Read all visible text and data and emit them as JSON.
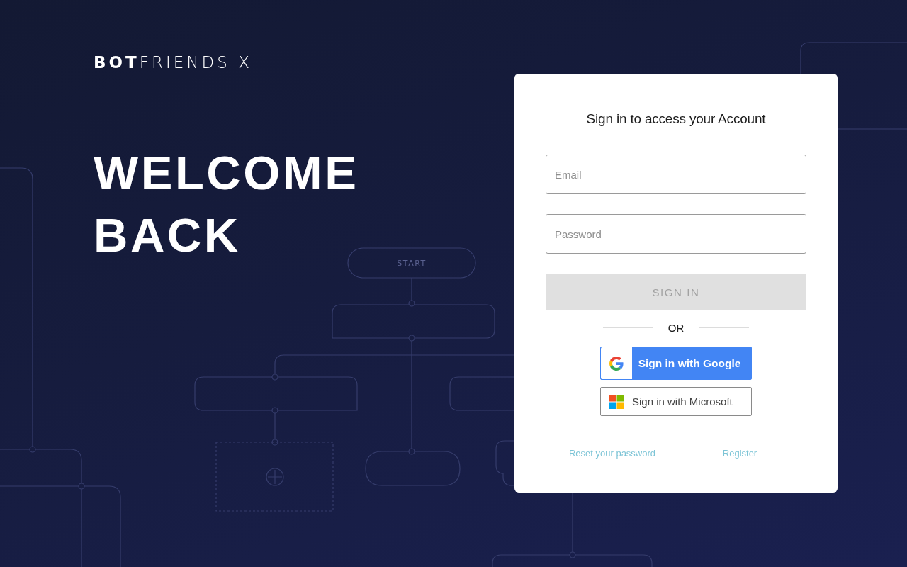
{
  "brand": {
    "logo": "**BOT**FRIENDS X"
  },
  "hero": {
    "heading": "WELCOME BACK"
  },
  "background": {
    "start_label": "START"
  },
  "login_card": {
    "title": "Sign in to access your Account",
    "fields": [
      {
        "placeholder": "Email"
      },
      {
        "placeholder": "Password"
      }
    ],
    "submit": {
      "label": "SIGN IN",
      "disabled": true
    },
    "divider_label": "OR",
    "social_buttons": [
      {
        "kind": "google",
        "label": "Sign in with Google"
      },
      {
        "kind": "microsoft",
        "label": "Sign in with Microsoft"
      }
    ],
    "links": [
      {
        "label": "Reset your password"
      },
      {
        "label": "Register"
      }
    ]
  }
}
